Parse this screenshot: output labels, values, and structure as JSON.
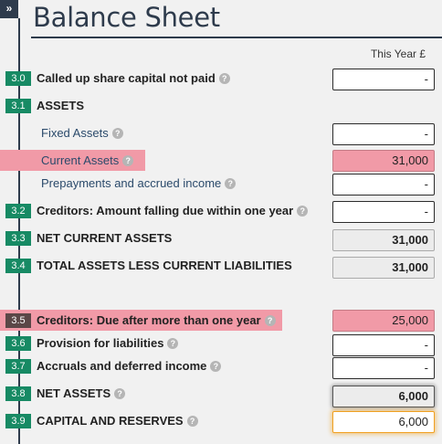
{
  "expand_icon": "»",
  "title": "Balance Sheet",
  "column_header": "This Year £",
  "help_icon": "?",
  "rows": {
    "r30": {
      "code": "3.0",
      "label": "Called up share capital not paid",
      "value": "-"
    },
    "r31": {
      "code": "3.1",
      "label": "ASSETS"
    },
    "fixed": {
      "label": "Fixed Assets",
      "value": "-"
    },
    "current": {
      "label": "Current Assets",
      "value": "31,000"
    },
    "prepay": {
      "label": "Prepayments and accrued income",
      "value": "-"
    },
    "r32": {
      "code": "3.2",
      "label": "Creditors: Amount falling due within one year",
      "value": "-"
    },
    "r33": {
      "code": "3.3",
      "label": "NET CURRENT ASSETS",
      "value": "31,000"
    },
    "r34": {
      "code": "3.4",
      "label": "TOTAL ASSETS LESS CURRENT LIABILITIES",
      "value": "31,000"
    },
    "r35": {
      "code": "3.5",
      "label": "Creditors: Due after more than one year",
      "value": "25,000"
    },
    "r36": {
      "code": "3.6",
      "label": "Provision for liabilities",
      "value": "-"
    },
    "r37": {
      "code": "3.7",
      "label": "Accruals and deferred income",
      "value": "-"
    },
    "r38": {
      "code": "3.8",
      "label": "NET ASSETS",
      "value": "6,000"
    },
    "r39": {
      "code": "3.9",
      "label": "CAPITAL AND RESERVES",
      "value": "6,000"
    }
  },
  "colors": {
    "accent": "#2e3b4c",
    "badge": "#178a64",
    "highlight": "#f19aa7",
    "focus": "#f0a020"
  }
}
